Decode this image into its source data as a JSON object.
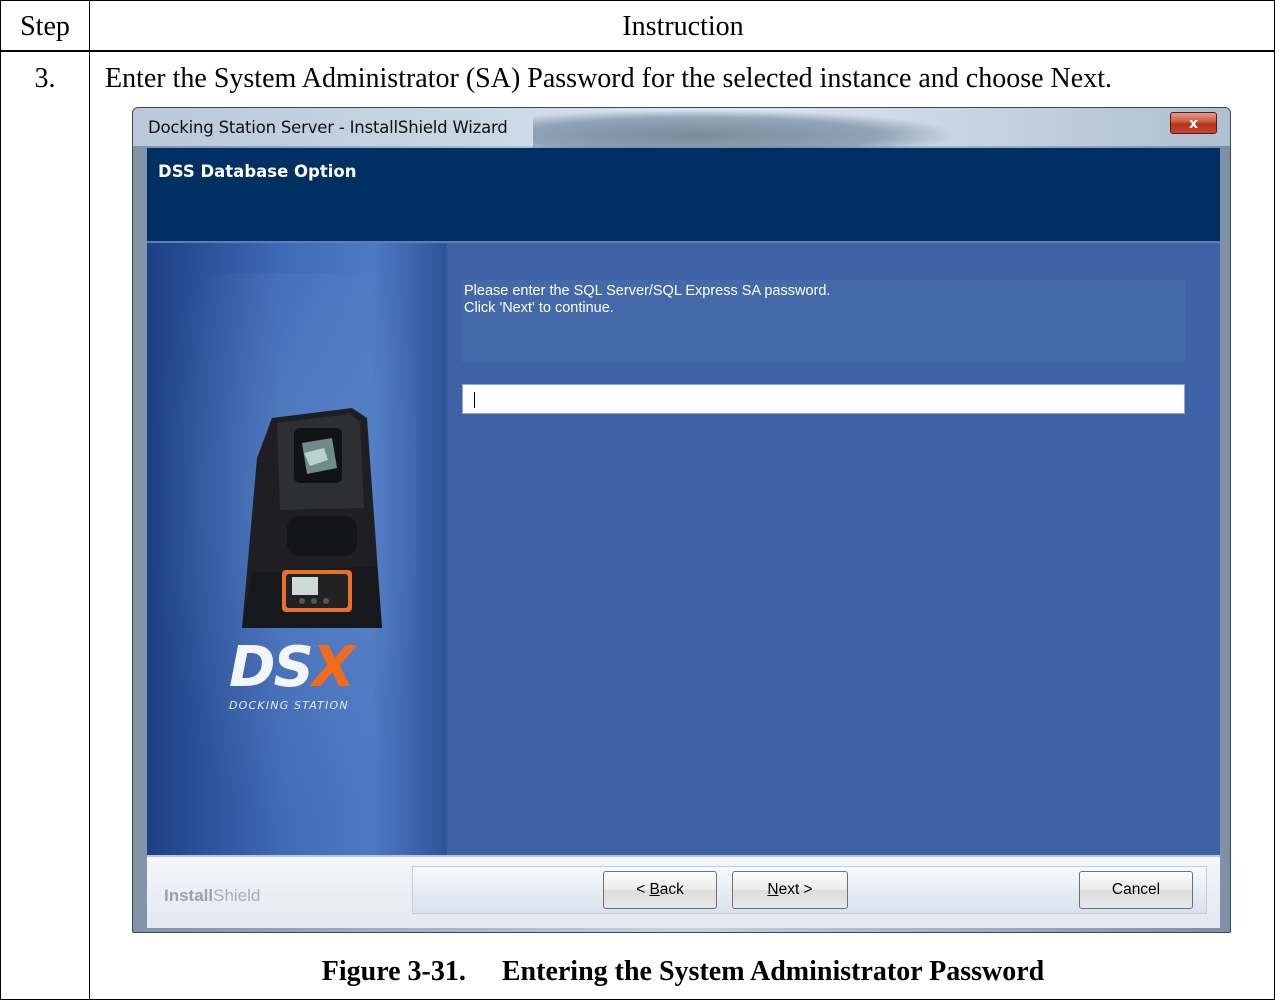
{
  "table": {
    "header_step": "Step",
    "header_instruction": "Instruction",
    "step_number": "3.",
    "instruction": "Enter the System Administrator (SA) Password for the selected instance and choose Next."
  },
  "wizard": {
    "window_title": "Docking Station Server - InstallShield Wizard",
    "close_glyph": "x",
    "page_title": "DSS Database Option",
    "prompt_line1": "Please enter the SQL Server/SQL Express SA password.",
    "prompt_line2": "Click 'Next' to continue.",
    "password_value": "",
    "logo_ds": "DS",
    "logo_x": "X",
    "logo_subtitle": "DOCKING STATION",
    "brand_bold": "Install",
    "brand_light": "Shield",
    "back_prefix": "< ",
    "back_mnemonic": "B",
    "back_rest": "ack",
    "next_mnemonic": "N",
    "next_rest": "ext >",
    "cancel_label": "Cancel"
  },
  "caption": {
    "figure": "Figure 3-31.",
    "text": "Entering the System Administrator Password"
  },
  "colors": {
    "header_band": "#002f64",
    "client_bg": "#3f62a6",
    "logo_accent": "#f06c1a",
    "close_button": "#c9452b"
  }
}
